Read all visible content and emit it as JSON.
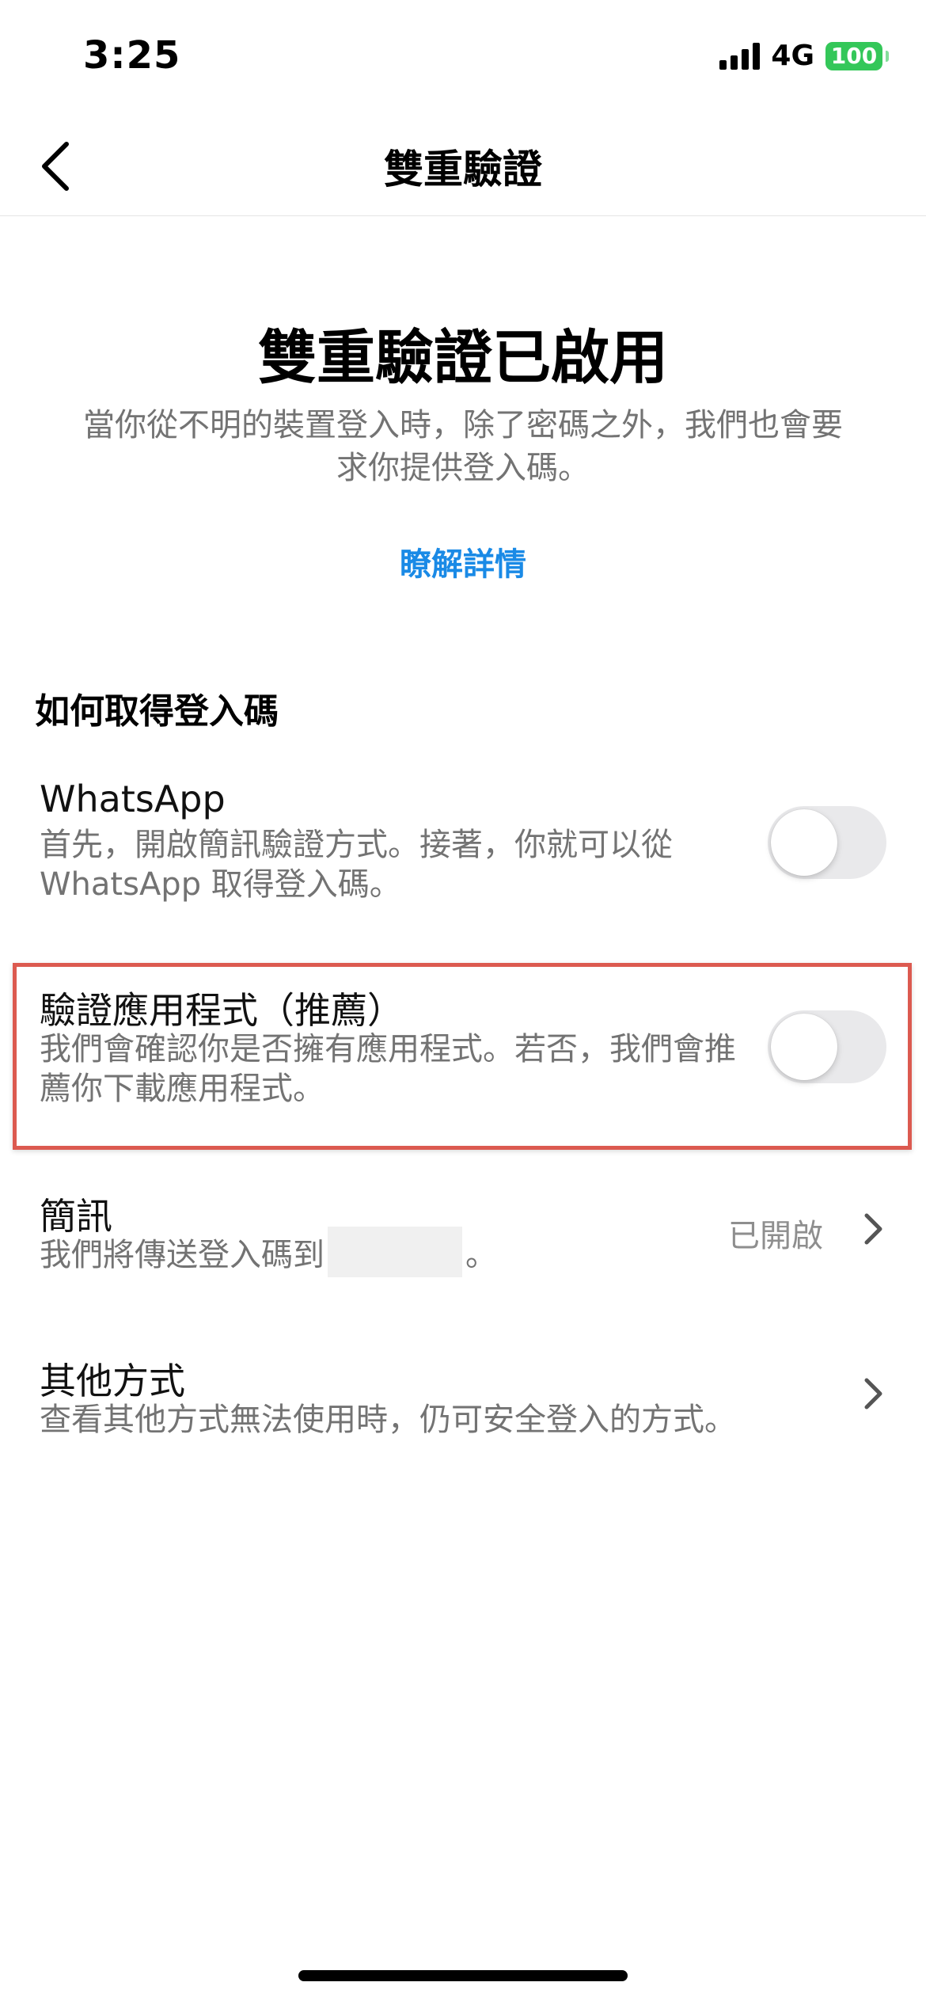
{
  "status_bar": {
    "time": "3:25",
    "network": "4G",
    "battery": "100"
  },
  "header": {
    "title": "雙重驗證",
    "back_icon": "chevron-left-icon"
  },
  "hero": {
    "title": "雙重驗證已啟用",
    "description": "當你從不明的裝置登入時，除了密碼之外，我們也會要求你提供登入碼。",
    "learn_more": "瞭解詳情"
  },
  "section": {
    "heading": "如何取得登入碼"
  },
  "options": {
    "whatsapp": {
      "title": "WhatsApp",
      "description": "首先，開啟簡訊驗證方式。接著，你就可以從 WhatsApp 取得登入碼。",
      "enabled": false
    },
    "auth_app": {
      "title": "驗證應用程式（推薦）",
      "description": "我們會確認你是否擁有應用程式。若否，我們會推薦你下載應用程式。",
      "enabled": false
    },
    "sms": {
      "title": "簡訊",
      "description_prefix": "我們將傳送登入碼到",
      "description_suffix": "。",
      "status": "已開啟"
    },
    "other": {
      "title": "其他方式",
      "description": "查看其他方式無法使用時，仍可安全登入的方式。"
    }
  },
  "colors": {
    "accent_link": "#1a8ae6",
    "highlight_border": "#dc5a50",
    "toggle_off": "#e9e9eb",
    "battery": "#34c759"
  }
}
